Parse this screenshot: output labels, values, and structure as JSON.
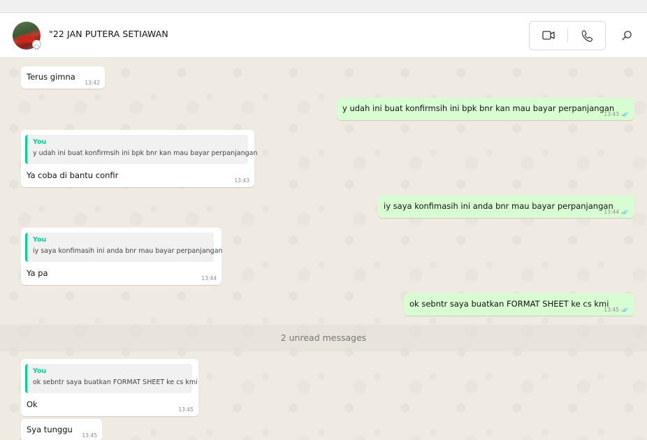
{
  "contact": {
    "name": "\"22 JAN PUTERA SETIAWAN"
  },
  "header": {
    "video_icon": "video-camera-icon",
    "voice_icon": "phone-icon",
    "search_icon": "search-icon"
  },
  "colors": {
    "incoming_bubble": "#ffffff",
    "outgoing_bubble": "#d9fdd3",
    "quote_accent": "#06cf9c",
    "read_check": "#53bdeb",
    "chat_background": "#efeae2"
  },
  "messages": [
    {
      "direction": "in",
      "text": "Terus gimna",
      "time": "13:42"
    },
    {
      "direction": "out",
      "text": "y udah ini buat konfirmsih ini bpk bnr kan mau bayar perpanjangan",
      "time": "13:43",
      "status": "read"
    },
    {
      "direction": "in",
      "quote_author": "You",
      "quote_text": "y udah ini buat konfirmsih ini bpk bnr kan mau bayar perpanjangan",
      "text": "Ya coba di bantu confir",
      "time": "13:43"
    },
    {
      "direction": "out",
      "text": "iy saya konfimasih ini anda bnr mau bayar perpanjangan",
      "time": "13:44",
      "status": "read"
    },
    {
      "direction": "in",
      "quote_author": "You",
      "quote_text": "iy saya konfimasih ini anda bnr mau bayar perpanjangan",
      "text": "Ya pa",
      "time": "13:44"
    },
    {
      "direction": "out",
      "text": "ok sebntr saya buatkan FORMAT SHEET ke cs kmi",
      "time": "13:45",
      "status": "read"
    },
    {
      "direction": "in",
      "quote_author": "You",
      "quote_text": "ok sebntr saya buatkan FORMAT SHEET ke cs kmi",
      "text": "Ok",
      "time": "13:45"
    },
    {
      "direction": "in",
      "text": "Sya tunggu",
      "time": "13:45"
    }
  ],
  "unread_divider": "2 unread messages"
}
